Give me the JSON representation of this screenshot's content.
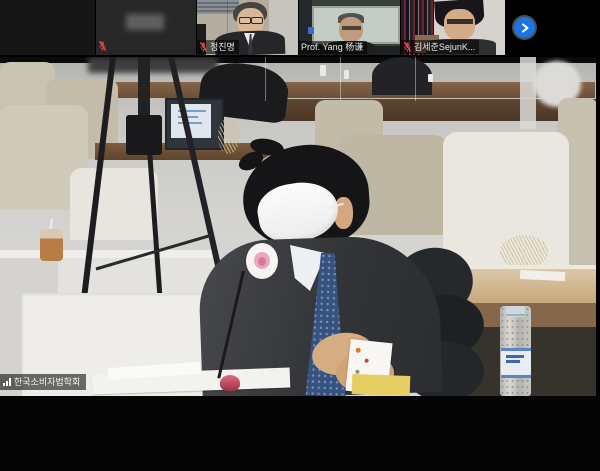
{
  "filmstrip": {
    "participants": [
      {
        "name": "",
        "muted_icon_visible": false
      },
      {
        "name": "",
        "muted_icon_visible": true
      },
      {
        "name": "정진명",
        "muted_icon_visible": true
      },
      {
        "name": "Prof. Yang 杨谦",
        "muted_icon_visible": false
      },
      {
        "name": "김세준SejunK...",
        "muted_icon_visible": true
      }
    ],
    "next_button": {
      "icon": "chevron-right",
      "color": "#1b74e4"
    }
  },
  "main_video": {
    "watermark": {
      "icon": "signal-bars",
      "text": "한국소비자법학회"
    }
  },
  "colors": {
    "background": "#000000",
    "muted_mic_red": "#d34040",
    "next_button_blue": "#1b74e4",
    "label_badge_bg": "rgba(0,0,0,0.55)"
  }
}
